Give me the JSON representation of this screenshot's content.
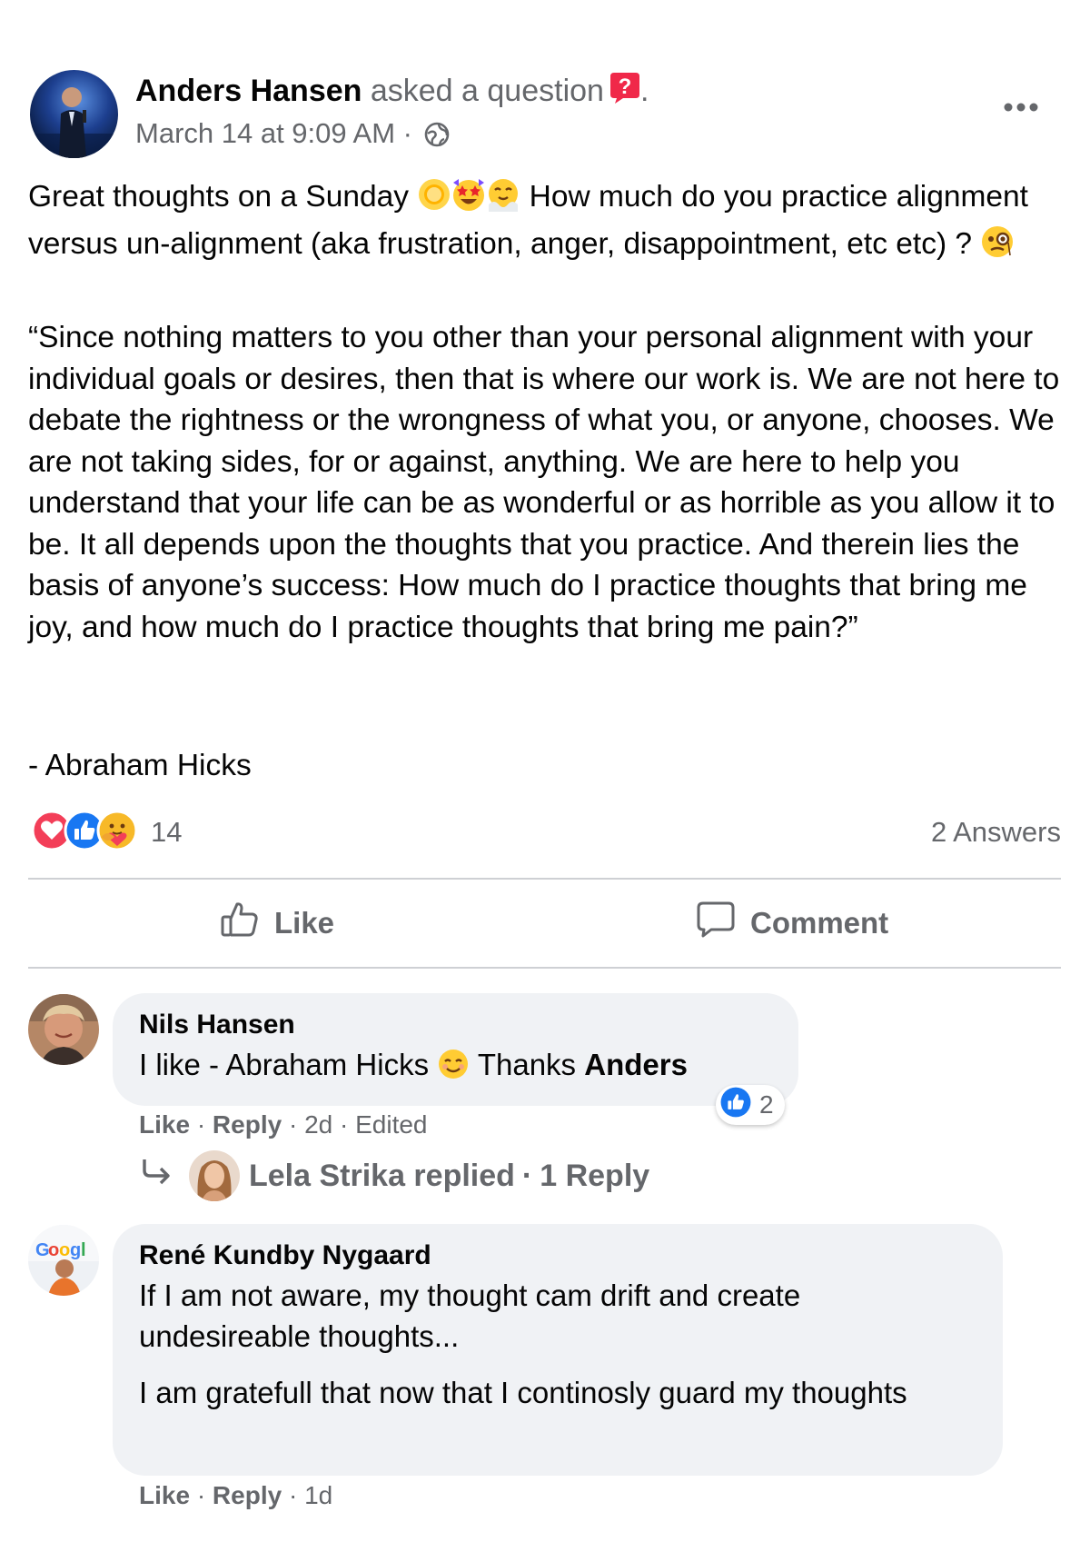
{
  "post": {
    "author": "Anders Hansen",
    "action_text": "asked a question",
    "action_suffix": ".",
    "timestamp": "March 14 at 9:09 AM",
    "meta_separator": "·",
    "audience_icon": "globe-icon",
    "more_icon": "more-options-icon",
    "paragraph1": {
      "text_a": "Great thoughts on a Sunday ",
      "emojis_a": [
        "sun-emoji",
        "star-struck-emoji",
        "face-with-steam-emoji"
      ],
      "text_b": " How much do you practice alignment versus un-alignment (aka frustration, anger, disappointment, etc etc) ? ",
      "emoji_b": "face-with-monocle-emoji"
    },
    "paragraph2": "“Since nothing matters to you other than your personal alignment with your individual goals or desires, then that is where our work is. We are not here to debate the rightness or the wrongness of what you, or anyone, chooses. We are not taking sides, for or against, anything. We are here to help you understand that your life can be as wonderful or as horrible as you allow it to be. It all depends upon the thoughts that you practice. And therein lies the basis of anyone’s success: How much do I practice thoughts that bring me joy, and how much do I practice thoughts that bring me pain?”",
    "paragraph3": "- Abraham Hicks",
    "reactions": {
      "icons": [
        "love-reaction-icon",
        "like-reaction-icon",
        "care-reaction-icon"
      ],
      "count": "14"
    },
    "answers_label": "2 Answers"
  },
  "actions": {
    "like_label": "Like",
    "comment_label": "Comment"
  },
  "comments": [
    {
      "author": "Nils Hansen",
      "text_a": "I like - Abraham Hicks ",
      "emoji": "smiling-face-emoji",
      "text_b": " Thanks ",
      "mention": "Anders",
      "like_label": "Like",
      "reply_label": "Reply",
      "age": "2d",
      "edited": "Edited",
      "separator": "·",
      "like_count": "2",
      "replies": {
        "replier": "Lela Strika replied",
        "separator": "·",
        "count_label": "1 Reply"
      }
    },
    {
      "author": "René Kundby Nygaard",
      "line1": "If I am not aware, my thought cam drift and create undesireable thoughts...",
      "line2": "I am gratefull that now that I continosly guard my thoughts",
      "like_label": "Like",
      "reply_label": "Reply",
      "age": "1d",
      "separator": "·"
    }
  ],
  "colors": {
    "primary_text": "#050505",
    "secondary_text": "#65676b",
    "bubble": "#f0f2f5",
    "divider": "#ced0d4",
    "like_blue": "#1877f2",
    "love_red": "#f33e58",
    "question_red": "#f02849"
  }
}
